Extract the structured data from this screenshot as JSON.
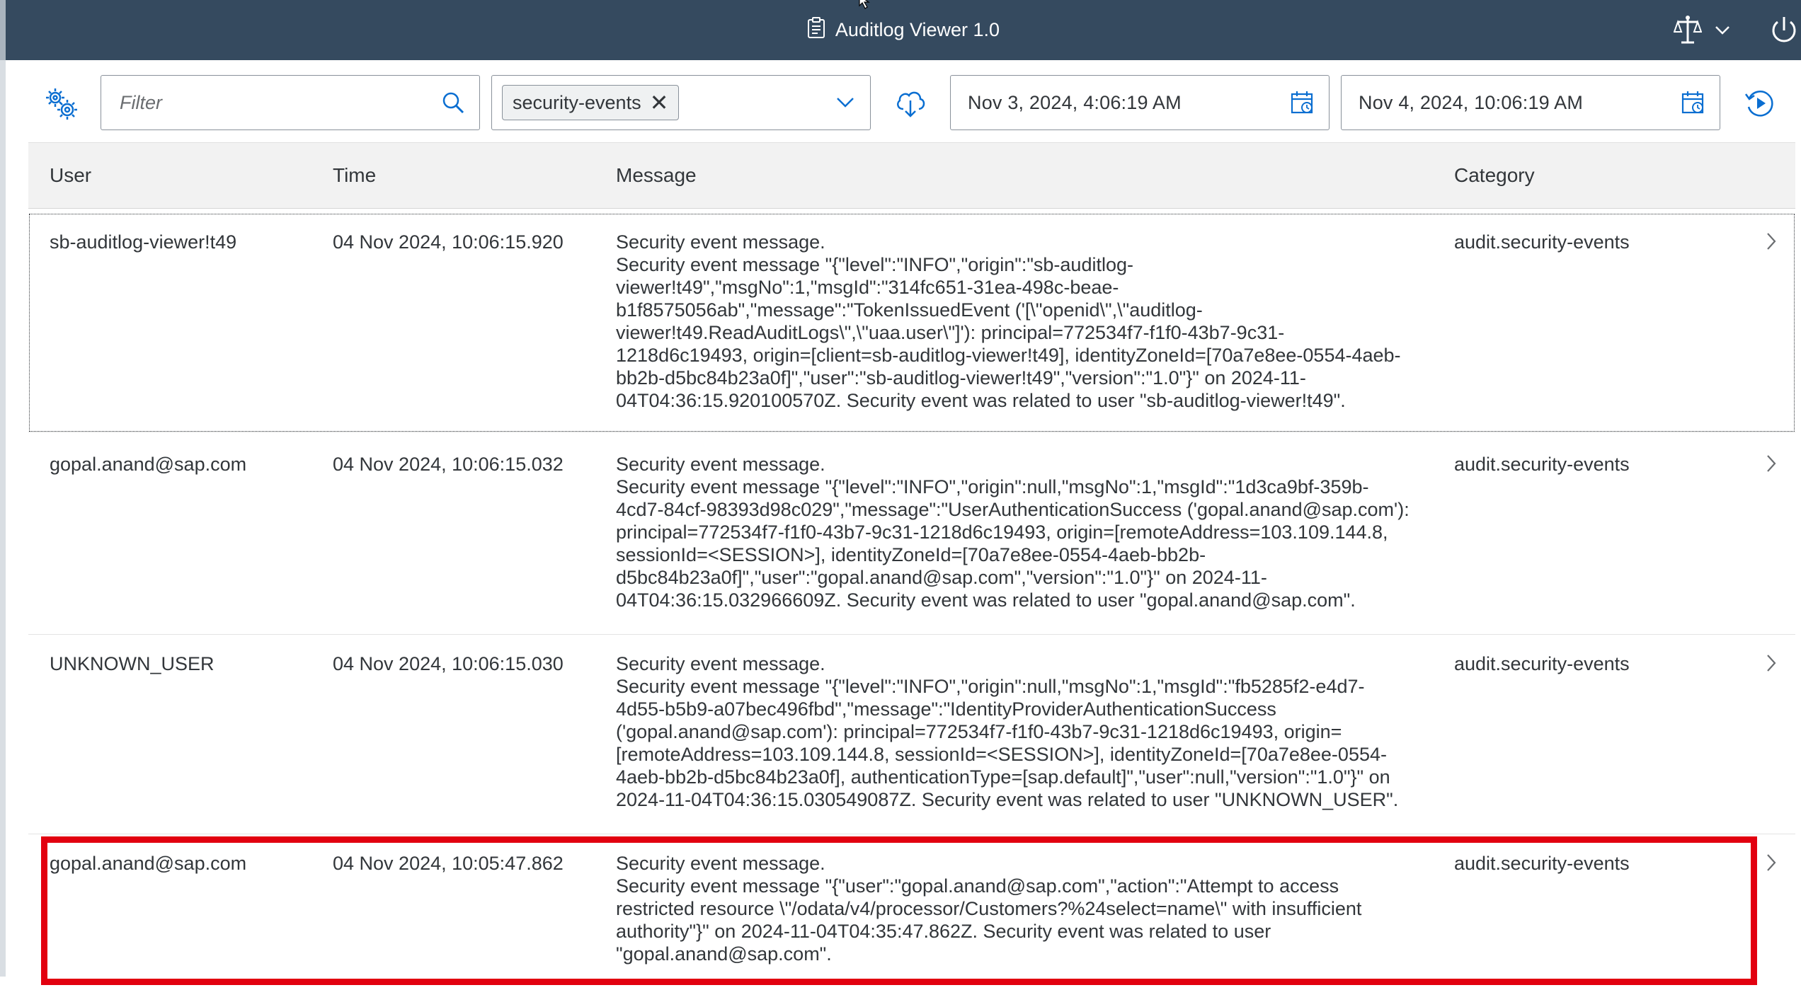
{
  "header": {
    "title": "Auditlog Viewer 1.0",
    "title_icon": "clipboard-icon",
    "right_icons": [
      "scales-icon",
      "chevron-down-icon",
      "power-icon"
    ]
  },
  "toolbar": {
    "settings_icon": "settings-gear-icon",
    "filter": {
      "placeholder": "Filter",
      "value": ""
    },
    "category_select": {
      "token_label": "security-events"
    },
    "download_icon": "cloud-download-icon",
    "from_date": "Nov 3, 2024, 4:06:19 AM",
    "to_date": "Nov 4, 2024, 10:06:19 AM",
    "refresh_icon": "refresh-icon"
  },
  "table": {
    "columns": {
      "user": "User",
      "time": "Time",
      "message": "Message",
      "category": "Category"
    },
    "rows": [
      {
        "user": "sb-auditlog-viewer!t49",
        "time": "04 Nov 2024, 10:06:15.920",
        "message_lines": [
          "Security event message.",
          "Security event message \"{\"level\":\"INFO\",\"origin\":\"sb-auditlog-",
          "viewer!t49\",\"msgNo\":1,\"msgId\":\"314fc651-31ea-498c-beae-",
          "b1f8575056ab\",\"message\":\"TokenIssuedEvent ('[\\\"openid\\\",\\\"auditlog-",
          "viewer!t49.ReadAuditLogs\\\",\\\"uaa.user\\\"]'): principal=772534f7-f1f0-43b7-9c31-",
          "1218d6c19493, origin=[client=sb-auditlog-viewer!t49], identityZoneId=[70a7e8ee-0554-4aeb-",
          "bb2b-d5bc84b23a0f]\",\"user\":\"sb-auditlog-viewer!t49\",\"version\":\"1.0\"}\" on 2024-11-",
          "04T04:36:15.920100570Z. Security event was related to user \"sb-auditlog-viewer!t49\"."
        ],
        "category": "audit.security-events"
      },
      {
        "user": "gopal.anand@sap.com",
        "time": "04 Nov 2024, 10:06:15.032",
        "message_lines": [
          "Security event message.",
          "Security event message \"{\"level\":\"INFO\",\"origin\":null,\"msgNo\":1,\"msgId\":\"1d3ca9bf-359b-",
          "4cd7-84cf-98393d98c029\",\"message\":\"UserAuthenticationSuccess ('gopal.anand@sap.com'):",
          "principal=772534f7-f1f0-43b7-9c31-1218d6c19493, origin=[remoteAddress=103.109.144.8,",
          "sessionId=<SESSION>], identityZoneId=[70a7e8ee-0554-4aeb-bb2b-",
          "d5bc84b23a0f]\",\"user\":\"gopal.anand@sap.com\",\"version\":\"1.0\"}\" on 2024-11-",
          "04T04:36:15.032966609Z. Security event was related to user \"gopal.anand@sap.com\"."
        ],
        "category": "audit.security-events"
      },
      {
        "user": "UNKNOWN_USER",
        "time": "04 Nov 2024, 10:06:15.030",
        "message_lines": [
          "Security event message.",
          "Security event message \"{\"level\":\"INFO\",\"origin\":null,\"msgNo\":1,\"msgId\":\"fb5285f2-e4d7-",
          "4d55-b5b9-a07bec496fbd\",\"message\":\"IdentityProviderAuthenticationSuccess",
          "('gopal.anand@sap.com'): principal=772534f7-f1f0-43b7-9c31-1218d6c19493, origin=",
          "[remoteAddress=103.109.144.8, sessionId=<SESSION>], identityZoneId=[70a7e8ee-0554-",
          "4aeb-bb2b-d5bc84b23a0f], authenticationType=[sap.default]\",\"user\":null,\"version\":\"1.0\"}\" on",
          "2024-11-04T04:36:15.030549087Z. Security event was related to user \"UNKNOWN_USER\"."
        ],
        "category": "audit.security-events"
      },
      {
        "user": "gopal.anand@sap.com",
        "time": "04 Nov 2024, 10:05:47.862",
        "message_lines": [
          "Security event message.",
          "Security event message \"{\"user\":\"gopal.anand@sap.com\",\"action\":\"Attempt to access",
          "restricted resource \\\"/odata/v4/processor/Customers?%24select=name\\\" with insufficient",
          "authority\"}\" on 2024-11-04T04:35:47.862Z. Security event was related to user",
          "\"gopal.anand@sap.com\"."
        ],
        "category": "audit.security-events"
      }
    ]
  },
  "colors": {
    "shell_header": "#354a5f",
    "highlight_border": "#e2000f",
    "table_header_bg": "#f2f2f2",
    "icon_blue": "#0a6ed1"
  }
}
